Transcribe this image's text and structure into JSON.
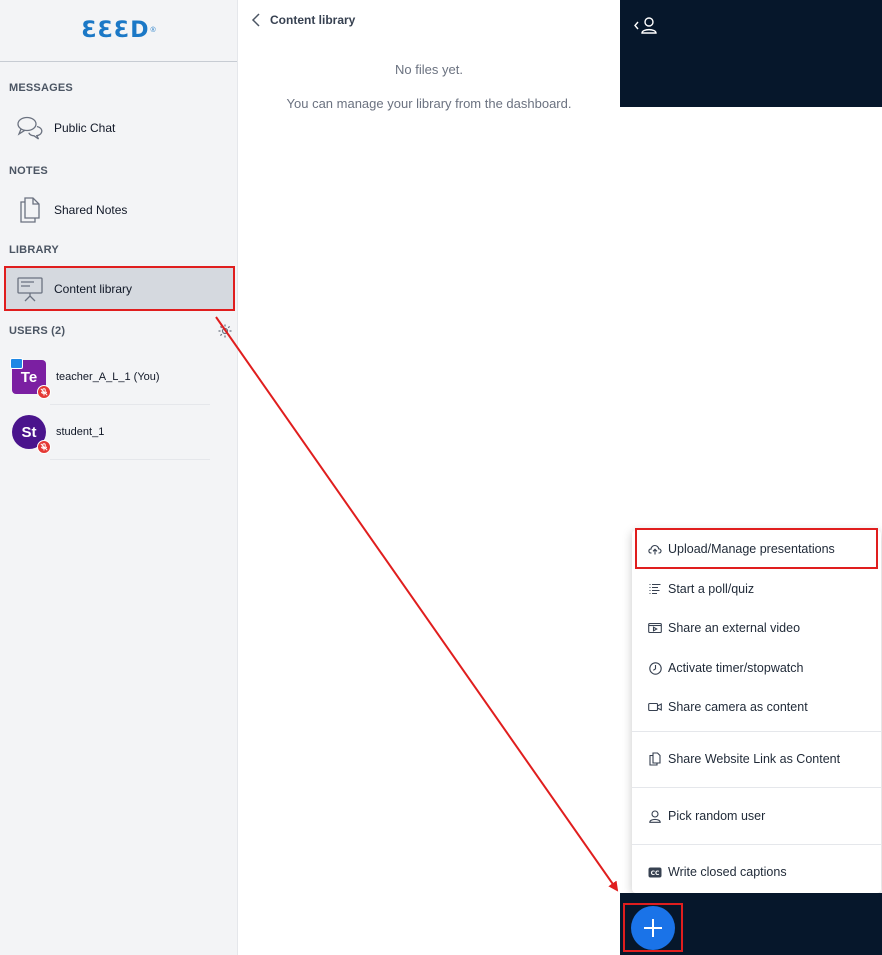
{
  "logo": {
    "text": "ƐƐƐD",
    "mark": "®"
  },
  "sidebar": {
    "messages_title": "MESSAGES",
    "public_chat": "Public Chat",
    "notes_title": "NOTES",
    "shared_notes": "Shared Notes",
    "library_title": "LIBRARY",
    "content_library": "Content library",
    "users_title": "USERS (2)",
    "users": [
      {
        "initials": "Te",
        "name": "teacher_A_L_1 (You)"
      },
      {
        "initials": "St",
        "name": "student_1"
      }
    ]
  },
  "content": {
    "header_title": "Content library",
    "empty_line1": "No files yet.",
    "empty_line2": "You can manage your library from the dashboard."
  },
  "menu": {
    "items": [
      {
        "label": "Upload/Manage presentations",
        "icon": "cloud-upload-icon"
      },
      {
        "label": "Start a poll/quiz",
        "icon": "list-icon"
      },
      {
        "label": "Share an external video",
        "icon": "video-icon"
      },
      {
        "label": "Activate timer/stopwatch",
        "icon": "clock-icon"
      },
      {
        "label": "Share camera as content",
        "icon": "camera-icon"
      },
      {
        "label": "Share Website Link as Content",
        "icon": "copy-icon"
      },
      {
        "label": "Pick random user",
        "icon": "user-icon"
      },
      {
        "label": "Write closed captions",
        "icon": "cc-icon"
      }
    ]
  },
  "fab": {
    "symbol": "+"
  },
  "colors": {
    "brand": "#1b78c6",
    "dark_panel": "#06172b",
    "fab": "#1a73e8",
    "highlight": "#e01e1e",
    "teacher_avatar": "#7b1fa2",
    "student_avatar": "#4a148c"
  }
}
